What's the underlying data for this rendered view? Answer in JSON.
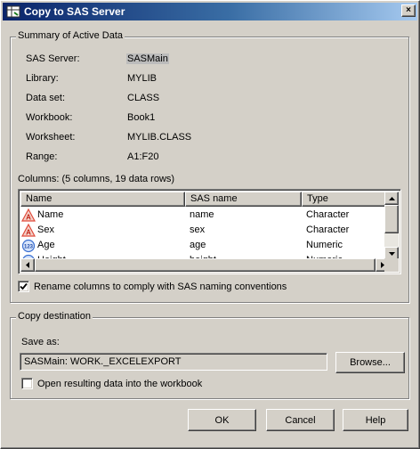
{
  "window": {
    "title": "Copy to SAS Server",
    "close_label": "×"
  },
  "summary": {
    "legend": "Summary of Active Data",
    "fields": [
      {
        "label": "SAS Server:",
        "value": "SASMain"
      },
      {
        "label": "Library:",
        "value": "MYLIB"
      },
      {
        "label": "Data set:",
        "value": "CLASS"
      },
      {
        "label": "Workbook:",
        "value": "Book1"
      },
      {
        "label": "Worksheet:",
        "value": "MYLIB.CLASS"
      },
      {
        "label": "Range:",
        "value": "A1:F20"
      }
    ],
    "columns_caption": "Columns: (5 columns, 19 data rows)",
    "table": {
      "headers": [
        "Name",
        "SAS name",
        "Type"
      ],
      "rows": [
        {
          "icon": "character-type-icon",
          "name": "Name",
          "sas_name": "name",
          "type": "Character"
        },
        {
          "icon": "character-type-icon",
          "name": "Sex",
          "sas_name": "sex",
          "type": "Character"
        },
        {
          "icon": "numeric-type-icon",
          "name": "Age",
          "sas_name": "age",
          "type": "Numeric"
        },
        {
          "icon": "numeric-type-icon",
          "name": "Height",
          "sas_name": "height",
          "type": "Numeric"
        }
      ]
    },
    "rename_checkbox": {
      "label": "Rename columns to comply with SAS naming conventions",
      "checked": true
    }
  },
  "destination": {
    "legend": "Copy destination",
    "save_as_label": "Save as:",
    "save_as_value": "SASMain: WORK._EXCELEXPORT",
    "browse_label": "Browse...",
    "open_checkbox": {
      "label": "Open resulting data into the workbook",
      "checked": false
    }
  },
  "buttons": {
    "ok": "OK",
    "cancel": "Cancel",
    "help": "Help"
  },
  "colors": {
    "title_gradient_start": "#0a246a",
    "title_gradient_end": "#a6caf0",
    "face": "#d4d0c8",
    "character_icon": "#e04a3a",
    "numeric_icon": "#3a6fd0"
  }
}
